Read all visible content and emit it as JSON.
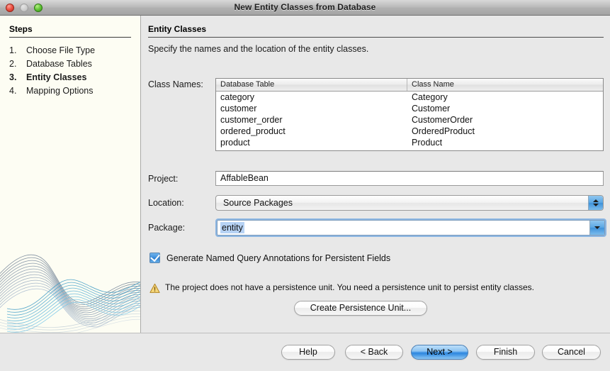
{
  "window": {
    "title": "New Entity Classes from Database",
    "controls": {
      "close": "close-button",
      "minimize": "minimize-button",
      "zoom": "zoom-button"
    }
  },
  "sidebar": {
    "heading": "Steps",
    "items": [
      {
        "number": "1.",
        "label": "Choose File Type",
        "current": false
      },
      {
        "number": "2.",
        "label": "Database Tables",
        "current": false
      },
      {
        "number": "3.",
        "label": "Entity Classes",
        "current": true
      },
      {
        "number": "4.",
        "label": "Mapping Options",
        "current": false
      }
    ]
  },
  "content": {
    "title": "Entity Classes",
    "subtitle": "Specify the names and the location of the entity classes."
  },
  "class_names": {
    "label": "Class Names:",
    "columns": [
      "Database Table",
      "Class Name"
    ],
    "rows": [
      [
        "category",
        "Category"
      ],
      [
        "customer",
        "Customer"
      ],
      [
        "customer_order",
        "CustomerOrder"
      ],
      [
        "ordered_product",
        "OrderedProduct"
      ],
      [
        "product",
        "Product"
      ]
    ]
  },
  "project": {
    "label": "Project:",
    "value": "AffableBean"
  },
  "location": {
    "label": "Location:",
    "value": "Source Packages"
  },
  "package": {
    "label": "Package:",
    "value": "entity"
  },
  "named_query_checkbox": {
    "label": "Generate Named Query Annotations for Persistent Fields",
    "checked": true
  },
  "warning": {
    "icon": "warning-triangle-icon",
    "text": "The project does not have a persistence unit. You need a persistence unit to persist entity classes.",
    "accent": "#e8b33c"
  },
  "create_persistence_unit_button": {
    "label": "Create Persistence Unit..."
  },
  "footer": {
    "buttons": [
      {
        "label": "Help",
        "default": false
      },
      {
        "label": "< Back",
        "default": false
      },
      {
        "label": "Next >",
        "default": true
      },
      {
        "label": "Finish",
        "default": false
      },
      {
        "label": "Cancel",
        "default": false
      }
    ]
  },
  "colors": {
    "sidebar_bg": "#fdfdf3",
    "content_bg": "#e8e8e8",
    "accent_blue": "#3f92da",
    "selection_blue": "#b6d2f4"
  }
}
